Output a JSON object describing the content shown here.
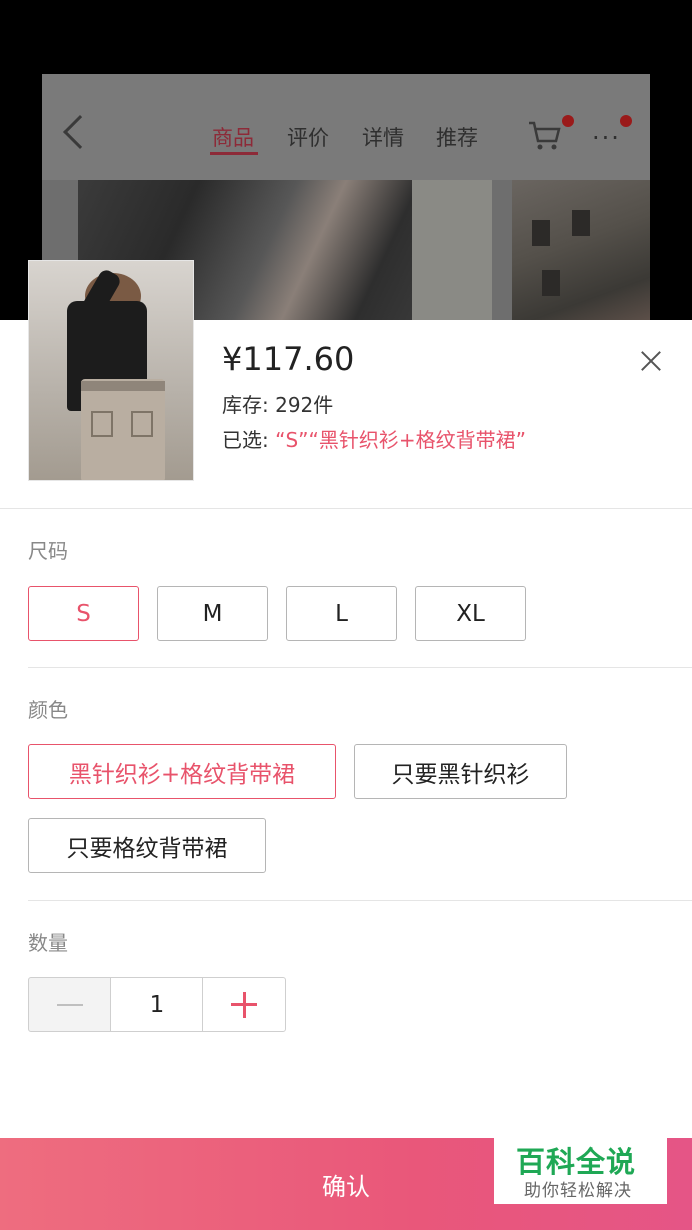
{
  "background_page": {
    "tabs": [
      {
        "label": "商品",
        "active": true
      },
      {
        "label": "评价",
        "active": false
      },
      {
        "label": "详情",
        "active": false
      },
      {
        "label": "推荐",
        "active": false
      }
    ],
    "icons": [
      "back-icon",
      "cart-icon",
      "more-icon"
    ]
  },
  "product": {
    "price": "¥117.60",
    "stock": "库存: 292件",
    "selected_prefix": "已选: ",
    "selected_value": "“S”“黑针织衫+格纹背带裙”"
  },
  "size": {
    "label": "尺码",
    "options": [
      "S",
      "M",
      "L",
      "XL"
    ],
    "selected": "S"
  },
  "color": {
    "label": "颜色",
    "options": [
      "黑针织衫+格纹背带裙",
      "只要黑针织衫",
      "只要格纹背带裙"
    ],
    "selected": "黑针织衫+格纹背带裙"
  },
  "quantity": {
    "label": "数量",
    "value": "1"
  },
  "confirm_label": "确认",
  "watermark": {
    "title": "百科全说",
    "subtitle": "助你轻松解决"
  },
  "colors": {
    "accent": "#e8536b",
    "watermark_green": "#1fa855"
  }
}
